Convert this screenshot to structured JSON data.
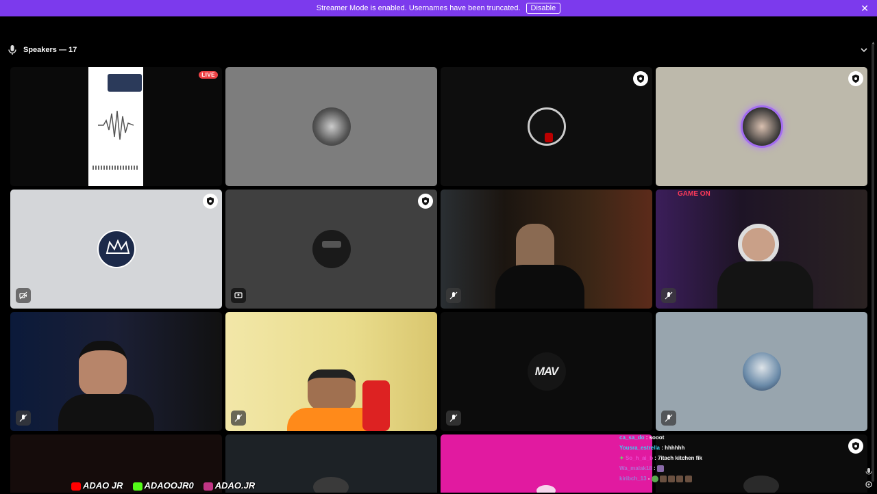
{
  "banner": {
    "message": "Streamer Mode is enabled. Usernames have been truncated.",
    "disable_label": "Disable",
    "close_icon": "close-icon",
    "color": "#7c3aed"
  },
  "header": {
    "speakers_label": "Speakers — 17",
    "mic_icon": "mic-icon",
    "collapse_icon": "chevron-down-icon"
  },
  "tiles": [
    {
      "id": "t1",
      "bg": "#0a0a0a",
      "live_label": "LIVE",
      "kind": "stream"
    },
    {
      "id": "t2",
      "bg": "#7d7d7d",
      "kind": "avatar"
    },
    {
      "id": "t3",
      "bg": "#0e0e0e",
      "kind": "avatar",
      "mod": true
    },
    {
      "id": "t4",
      "bg": "#bdb9ab",
      "kind": "avatar",
      "mod": true
    },
    {
      "id": "t5",
      "bg": "#d4d6d9",
      "kind": "avatar",
      "mod": true,
      "icon": "video-off-icon"
    },
    {
      "id": "t6",
      "bg": "#404040",
      "kind": "avatar",
      "mod": true,
      "icon": "screen-share-icon"
    },
    {
      "id": "t7",
      "bg": "#1b1510",
      "kind": "video",
      "icon": "mic-off-icon"
    },
    {
      "id": "t8",
      "bg": "#1e1426",
      "kind": "video",
      "icon": "mic-off-icon",
      "overlay_text": "GAME ON"
    },
    {
      "id": "t9",
      "bg": "#101522",
      "kind": "video",
      "icon": "mic-off-icon"
    },
    {
      "id": "t10",
      "bg": "#e9dc8c",
      "kind": "video",
      "icon": "mic-off-icon"
    },
    {
      "id": "t11",
      "bg": "#0c0c0c",
      "kind": "avatar",
      "avatar_text": "MAV",
      "icon": "mic-off-icon"
    },
    {
      "id": "t12",
      "bg": "#98a5ae",
      "kind": "avatar",
      "icon": "mic-off-icon"
    },
    {
      "id": "t13",
      "bg": "#150c0b",
      "kind": "video"
    },
    {
      "id": "t14",
      "bg": "#1d2226",
      "kind": "avatar"
    },
    {
      "id": "t15",
      "bg": "#e11aa0",
      "kind": "avatar"
    },
    {
      "id": "t16",
      "bg": "#0c0c0c",
      "kind": "avatar",
      "mod": true
    }
  ],
  "chat_overlay": [
    {
      "user": "ca_sa_do",
      "msg": "sooot",
      "color": "#5ec7f0"
    },
    {
      "user": "Yousra_estrella",
      "msg": "hhhhhh",
      "color": "#3bd0f0"
    },
    {
      "user": "So_h_ai_b",
      "msg": "7itach kitchen fik",
      "color": "#e94ccf"
    },
    {
      "user": "Wa_malak18",
      "msg": "",
      "color": "#b36dd4"
    },
    {
      "user": "kiribch_13",
      "msg": "",
      "color": "#9a7ad6"
    }
  ],
  "socials": [
    {
      "label": "ADAO JR",
      "icon": "youtube-icon",
      "color": "#ff0000"
    },
    {
      "label": "ADAOOJR0",
      "icon": "kick-icon",
      "color": "#53fc18"
    },
    {
      "label": "ADAO.JR",
      "icon": "instagram-icon",
      "color": "#c13584"
    }
  ]
}
